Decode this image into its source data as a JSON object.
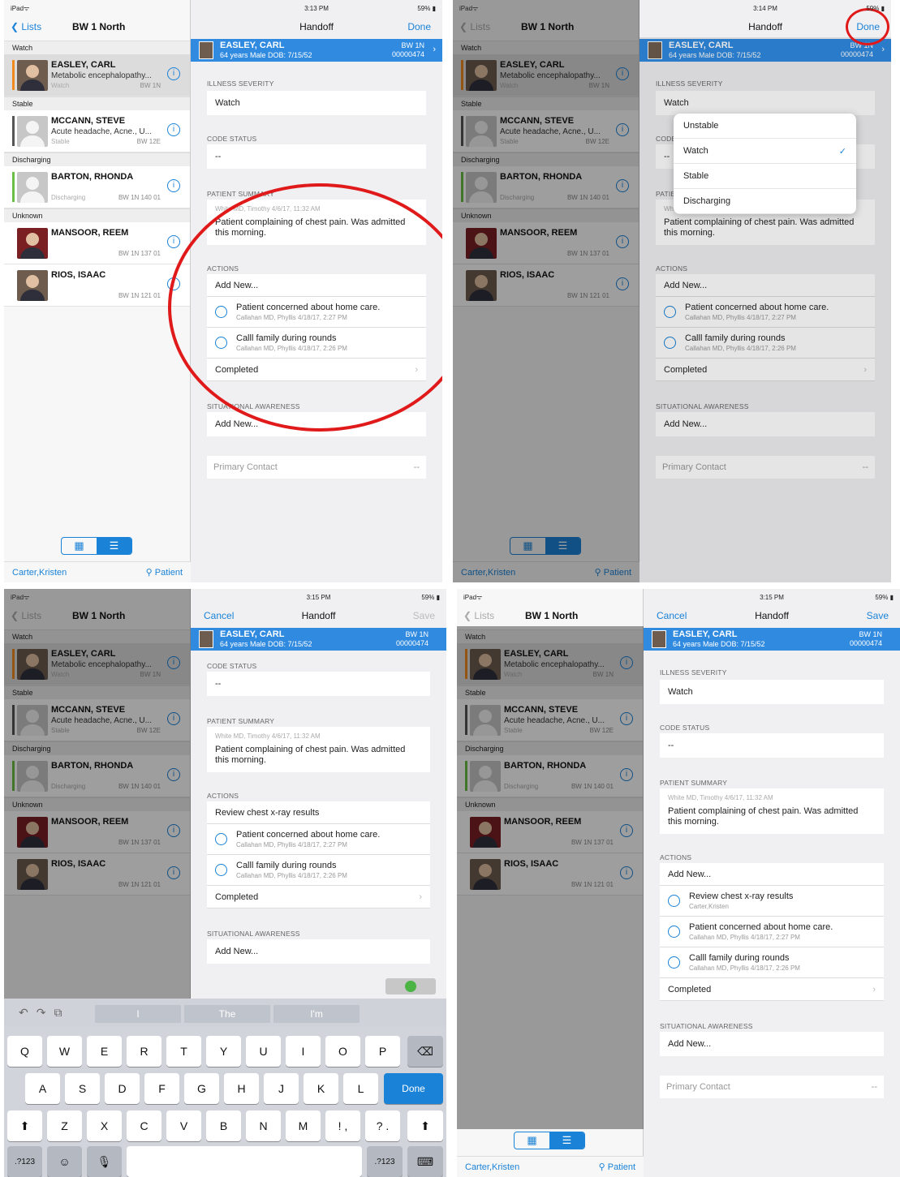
{
  "colors": {
    "accent": "#1a82d7",
    "banner": "#2f8ae0",
    "watch": "#f08a1e",
    "stable": "#555555",
    "discharging": "#6abe45",
    "annotation": "#e01a1a"
  },
  "status": {
    "device": "iPad ",
    "p1_time": "3:13 PM",
    "p2_time": "3:14 PM",
    "p3_time": "3:15 PM",
    "p4_time": "3:15 PM",
    "battery": "59%"
  },
  "sidebar": {
    "back": "Lists",
    "title": "BW 1 North",
    "sections": [
      "Watch",
      "Stable",
      "Discharging",
      "Unknown"
    ],
    "patients": [
      {
        "name": "EASLEY, CARL",
        "dx": "Metabolic encephalopathy...",
        "status": "Watch",
        "loc": "BW 1N"
      },
      {
        "name": "MCCANN, STEVE",
        "dx": "Acute headache, Acne., U...",
        "status": "Stable",
        "loc": "BW 12E"
      },
      {
        "name": "BARTON, RHONDA",
        "dx": "",
        "status": "Discharging",
        "loc": "BW 1N 140 01"
      },
      {
        "name": "MANSOOR, REEM",
        "dx": "",
        "status": "",
        "loc": "BW 1N 137 01"
      },
      {
        "name": "RIOS, ISAAC",
        "dx": "",
        "status": "",
        "loc": "BW 1N 121 01"
      }
    ],
    "footer_user": "Carter,Kristen",
    "footer_search": "Patient"
  },
  "handoff": {
    "title": "Handoff",
    "done": "Done",
    "cancel": "Cancel",
    "save": "Save",
    "banner": {
      "name": "EASLEY, CARL",
      "details": "64 years  Male  DOB: 7/15/52",
      "unit": "BW 1N",
      "mrn": "00000474"
    },
    "labels": {
      "illness": "ILLNESS SEVERITY",
      "code": "CODE STATUS",
      "summary": "PATIENT SUMMARY",
      "actions": "ACTIONS",
      "situational": "SITUATIONAL AWARENESS"
    },
    "illness_value": "Watch",
    "code_value": "--",
    "summary_meta": "White MD, Timothy 4/6/17, 11:32 AM",
    "summary_text": "Patient complaining of chest pain.  Was admitted this morning.",
    "add_new": "Add New...",
    "completed": "Completed",
    "actions": [
      {
        "text": "Patient concerned about home care.",
        "by": "Callahan MD, Phyllis 4/18/17, 2:27 PM"
      },
      {
        "text": "Calll family during rounds",
        "by": "Callahan MD, Phyllis 4/18/17, 2:26 PM"
      }
    ],
    "new_action": {
      "text": "Review chest x-ray results",
      "by": "Carter,Kristen"
    },
    "primary_contact": "Primary Contact",
    "primary_value": "--"
  },
  "severity_menu": {
    "options": [
      "Unstable",
      "Watch",
      "Stable",
      "Discharging"
    ],
    "selected": "Watch",
    "check": "✓"
  },
  "keyboard": {
    "suggestions": [
      "I",
      "The",
      "I'm"
    ],
    "row1": [
      "Q",
      "W",
      "E",
      "R",
      "T",
      "Y",
      "U",
      "I",
      "O",
      "P"
    ],
    "row2": [
      "A",
      "S",
      "D",
      "F",
      "G",
      "H",
      "J",
      "K",
      "L"
    ],
    "done": "Done",
    "row3": [
      "Z",
      "X",
      "C",
      "V",
      "B",
      "N",
      "M",
      "!\n,",
      "?\n."
    ],
    "num": ".?123"
  }
}
